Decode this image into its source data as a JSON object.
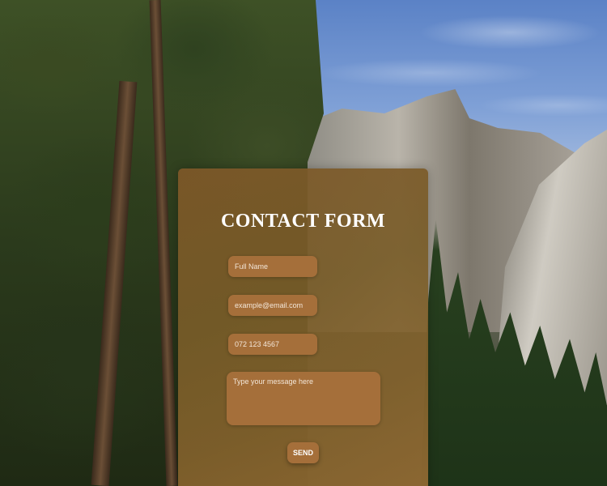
{
  "form": {
    "title": "CONTACT FORM",
    "full_name": {
      "value": "",
      "placeholder": "Full Name"
    },
    "email": {
      "value": "",
      "placeholder": "example@email.com"
    },
    "phone": {
      "value": "",
      "placeholder": "072 123 4567"
    },
    "message": {
      "value": "",
      "placeholder": "Type your message here"
    },
    "send_label": "SEND"
  },
  "colors": {
    "panel": "#7e5828",
    "field": "#a56f3a",
    "text": "#ffffff"
  }
}
